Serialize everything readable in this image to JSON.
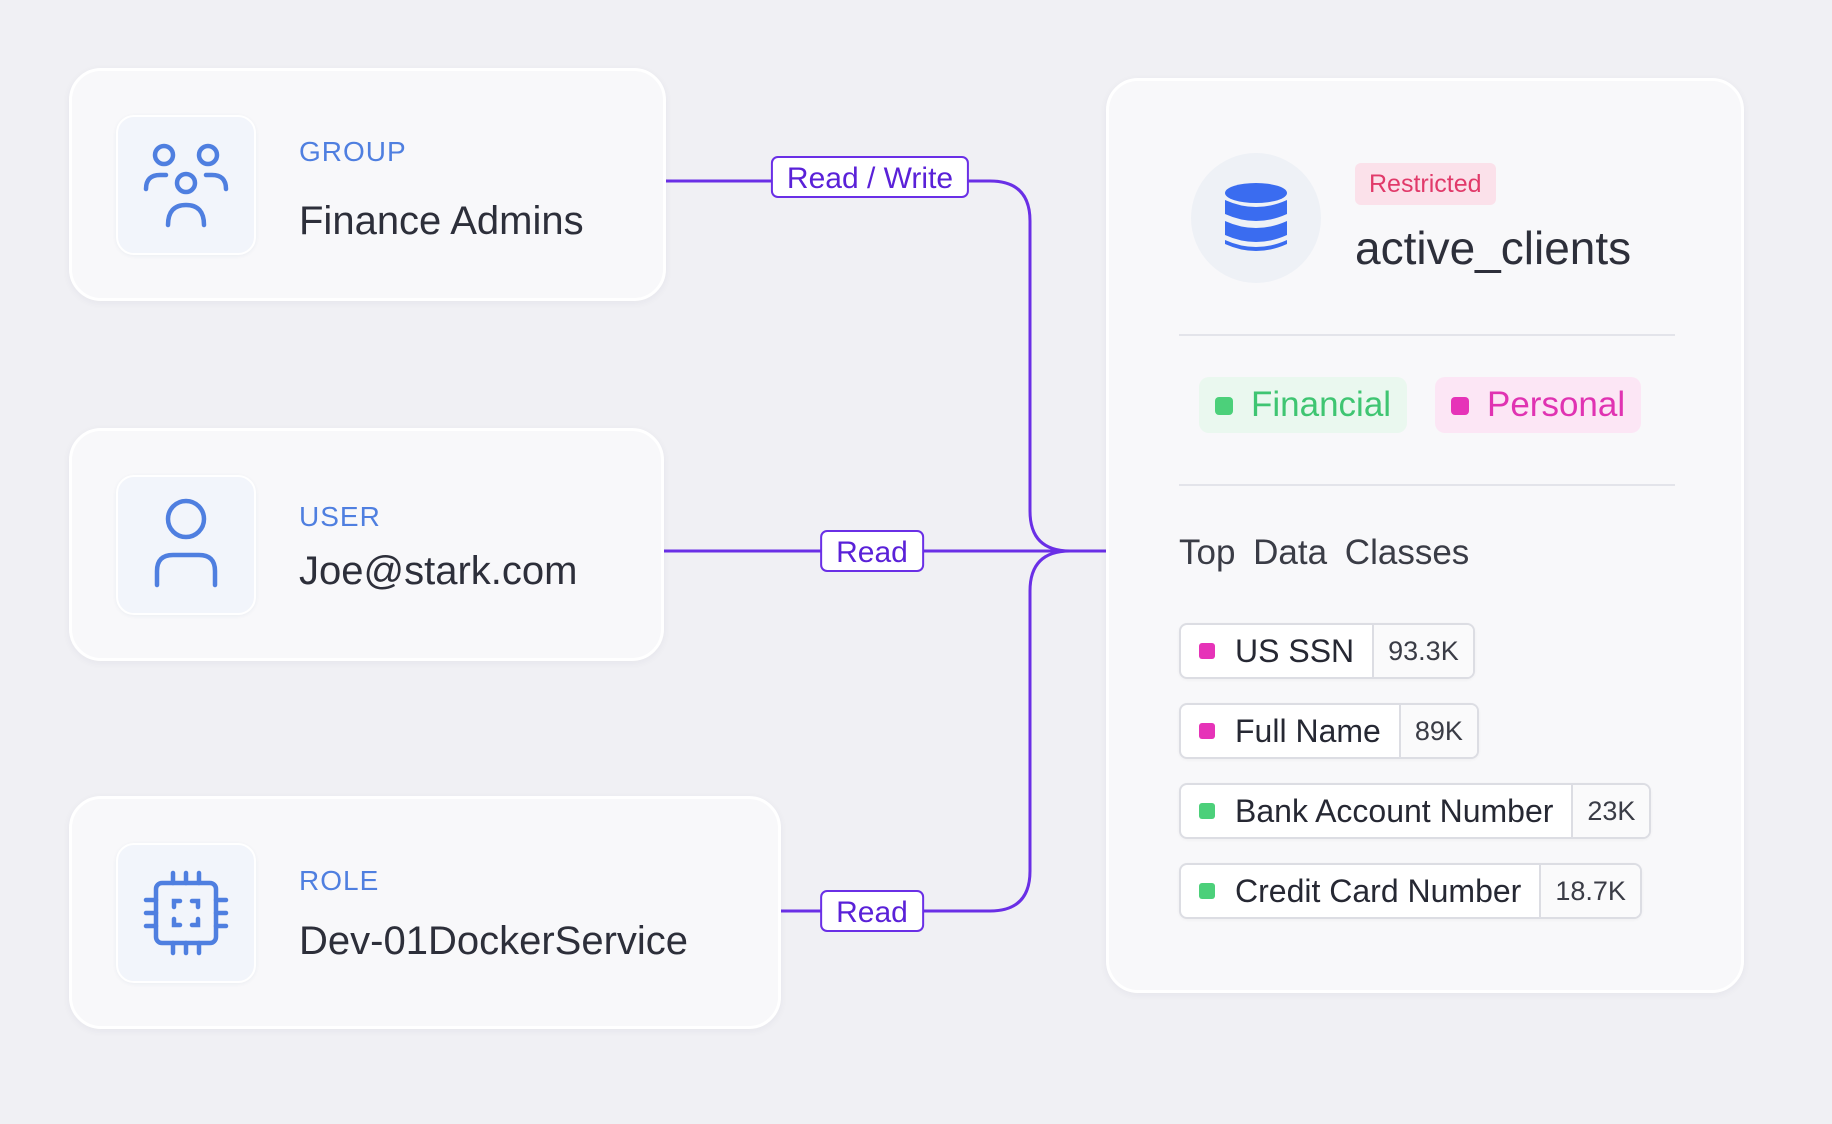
{
  "entities": [
    {
      "type_label": "GROUP",
      "name": "Finance Admins",
      "icon": "users-group-icon",
      "access": "Read / Write"
    },
    {
      "type_label": "USER",
      "name": "Joe@stark.com",
      "icon": "user-icon",
      "access": "Read"
    },
    {
      "type_label": "ROLE",
      "name": "Dev-01DockerService",
      "icon": "chip-icon",
      "access": "Read"
    }
  ],
  "dataset": {
    "icon": "database-icon",
    "badge": "Restricted",
    "name": "active_clients",
    "tags": [
      {
        "label": "Financial",
        "color": "#4cd07a",
        "bg": "#eaf8ef",
        "text_color": "#3fc572"
      },
      {
        "label": "Personal",
        "color": "#e633b8",
        "bg": "#fce6f5",
        "text_color": "#e033b2"
      }
    ],
    "section_title": "Top  Data Classes",
    "data_classes": [
      {
        "name": "US SSN",
        "count": "93.3K",
        "color": "#e633b8"
      },
      {
        "name": "Full Name",
        "count": "89K",
        "color": "#e633b8"
      },
      {
        "name": "Bank Account Number",
        "count": "23K",
        "color": "#4cd07a"
      },
      {
        "name": "Credit Card Number",
        "count": "18.7K",
        "color": "#4cd07a"
      }
    ]
  },
  "colors": {
    "connector": "#6a2fe6",
    "accent_blue": "#4f7fe0",
    "db_blue": "#3a6cf0"
  }
}
